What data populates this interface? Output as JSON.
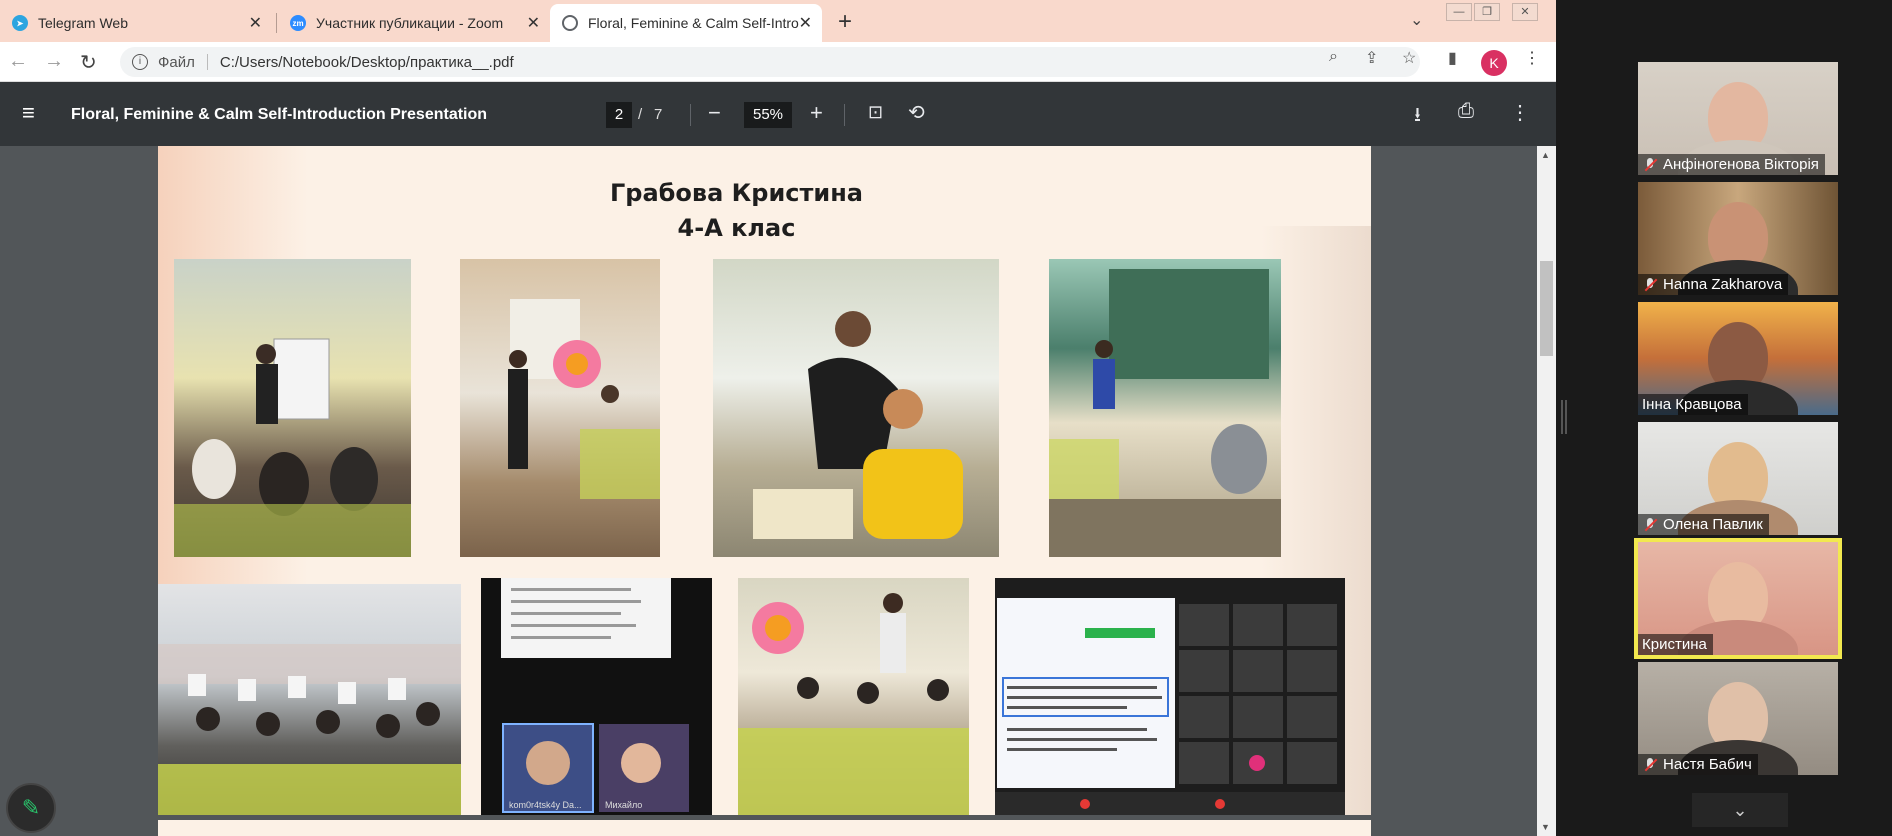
{
  "browser": {
    "tabs": [
      {
        "title": "Telegram Web",
        "icon": "telegram-icon"
      },
      {
        "title": "Участник публикации - Zoom",
        "icon": "zoom-icon"
      },
      {
        "title": "Floral, Feminine & Calm Self-Intro",
        "icon": "globe-icon",
        "active": true
      }
    ],
    "new_tab": "+",
    "tab_list": "⌄",
    "address": {
      "scheme_label": "Файл",
      "url": "C:/Users/Notebook/Desktop/практика__.pdf"
    },
    "profile_initial": "K"
  },
  "pdf_viewer": {
    "title": "Floral, Feminine & Calm Self-Introduction Presentation",
    "page_current": "2",
    "page_separator": "/",
    "page_total": "7",
    "zoom": "55%"
  },
  "slide": {
    "title_line1": "Грабова Кристина",
    "title_line2": "4-А клас",
    "photos": [
      {
        "name": "classroom-photo-1",
        "content": "teacher-at-flipchart"
      },
      {
        "name": "classroom-photo-2",
        "content": "student-at-board"
      },
      {
        "name": "classroom-photo-3",
        "content": "teacher-helping-student"
      },
      {
        "name": "classroom-photo-4",
        "content": "student-at-chalkboard"
      },
      {
        "name": "classroom-photo-5",
        "content": "class-raising-papers"
      },
      {
        "name": "online-lesson-screenshot-1",
        "content": "video-call-participants"
      },
      {
        "name": "classroom-photo-6",
        "content": "students-at-desks"
      },
      {
        "name": "online-lesson-screenshot-2",
        "content": "video-call-lesson"
      }
    ]
  },
  "zoom_gallery": {
    "participants": [
      {
        "name": "Анфіногенова Вікторія",
        "muted": true
      },
      {
        "name": "Hanna Zakharova",
        "muted": true
      },
      {
        "name": "Інна Кравцова",
        "muted": false
      },
      {
        "name": "Олена Павлик",
        "muted": true
      },
      {
        "name": "Кристина",
        "muted": false,
        "active_speaker": true
      },
      {
        "name": "Настя Бабич",
        "muted": true
      }
    ]
  },
  "colors": {
    "tab_bar": "#f9d9cc",
    "pdf_toolbar": "#323639",
    "pdf_background": "#525659",
    "slide_background": "#fcf1e6",
    "active_speaker_border": "#f2e84f",
    "profile_badge": "#d93062"
  }
}
